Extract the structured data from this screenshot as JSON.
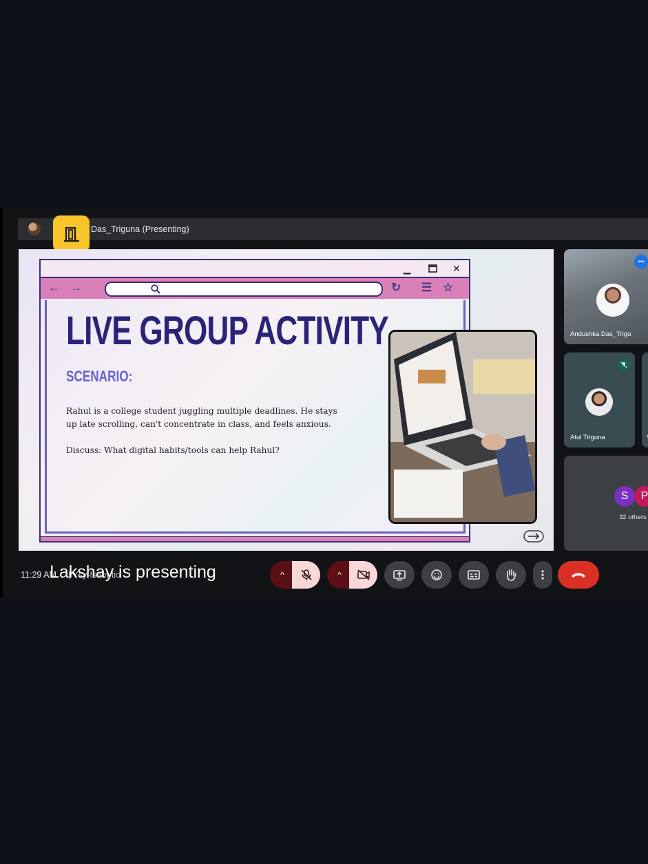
{
  "topbar": {
    "presenter_label": "Das_Triguna (Presenting)"
  },
  "slide": {
    "title": "LIVE GROUP ACTIVITY",
    "subtitle": "SCENARIO:",
    "scenario_text": "Rahul is a college student juggling multiple deadlines. He stays up late scrolling, can't concentrate in class, and feels anxious.",
    "discussion_prompt": "Discuss: What digital habits/tools can help Rahul?"
  },
  "participants": {
    "tile1_name": "Andushka Das_Trigu",
    "tile2_name": "Atul Triguna",
    "tile2b_name": "V",
    "chips": [
      "S",
      "P"
    ],
    "others_count": "32 others"
  },
  "bottom_bar": {
    "time": "11:29 AM",
    "meeting_code": "| Ysy-fsabt-tio",
    "presenting_banner": "Lakshay is presenting"
  },
  "colors": {
    "background": "#0d1117",
    "end_call": "#d93025",
    "speaking_indicator": "#1a73e8",
    "slide_heading": "#2a2478",
    "badge_yellow": "#f7c52a"
  },
  "icons": [
    "door-icon",
    "mic-off-icon",
    "camera-off-icon",
    "present-icon",
    "emoji-icon",
    "captions-icon",
    "raise-hand-icon",
    "more-options-icon",
    "end-call-icon",
    "next-arrow-icon"
  ]
}
